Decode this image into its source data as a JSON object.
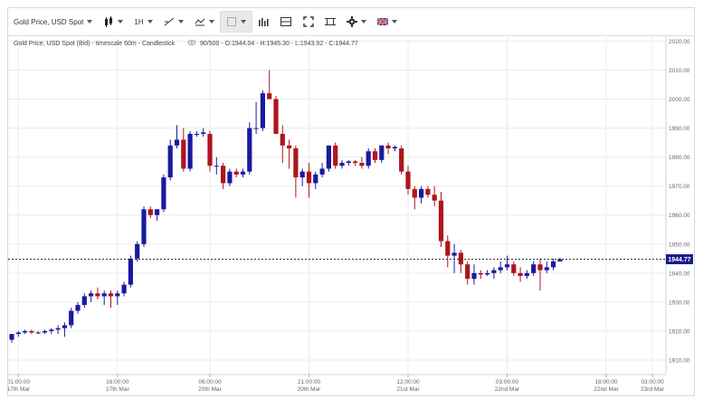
{
  "toolbar": {
    "instrument_label": "Gold Price, USD Spot",
    "timeframe_label": "1H"
  },
  "info_line": "Gold Price, USD Spot (Bid) - timescale 60m - Candlestick",
  "info_stats": "90/500 - O:1944.04 - H:1945.30 - L:1943.92 - C:1944.77",
  "current_price_label": "1944.77",
  "colors": {
    "up": "#1a1aa0",
    "down": "#b0141e",
    "grid": "#ececec",
    "axis_text": "#666666",
    "price_tag": "#1a1a8c"
  },
  "chart_data": {
    "type": "candlestick",
    "ylim": [
      1905,
      2022
    ],
    "yticks": [
      2020,
      2010,
      2000,
      1990,
      1980,
      1970,
      1960,
      1950,
      1940,
      1930,
      1920,
      1910
    ],
    "ytick_labels": [
      "2020.00",
      "2010.00",
      "2000.00",
      "1990.00",
      "1980.00",
      "1970.00",
      "1960.00",
      "1950.00",
      "1940.00",
      "1930.00",
      "1920.00",
      "1910.00"
    ],
    "xticks": [
      {
        "time": "01:00:00",
        "date": "17th Mar",
        "index": 1
      },
      {
        "time": "16:00:00",
        "date": "17th Mar",
        "index": 16
      },
      {
        "time": "06:00:00",
        "date": "20th Mar",
        "index": 30
      },
      {
        "time": "21:00:00",
        "date": "20th Mar",
        "index": 45
      },
      {
        "time": "12:00:00",
        "date": "21st Mar",
        "index": 60
      },
      {
        "time": "03:00:00",
        "date": "22nd Mar",
        "index": 75
      },
      {
        "time": "18:00:00",
        "date": "22nd Mar",
        "index": 90
      },
      {
        "time": "03:00:00",
        "date": "23rd Mar",
        "index": 97
      }
    ],
    "current_price": 1944.77,
    "candles": [
      [
        1917,
        1919,
        1916,
        1919
      ],
      [
        1919,
        1920,
        1918,
        1919.5
      ],
      [
        1919.5,
        1920.5,
        1919,
        1920
      ],
      [
        1920,
        1920.5,
        1919,
        1919.5
      ],
      [
        1919.5,
        1920,
        1919,
        1919.5
      ],
      [
        1919.5,
        1920.5,
        1919,
        1920
      ],
      [
        1920,
        1921,
        1919,
        1920.5
      ],
      [
        1920.5,
        1922,
        1919,
        1921
      ],
      [
        1921,
        1923,
        1918,
        1922
      ],
      [
        1922,
        1928,
        1921,
        1927
      ],
      [
        1927,
        1930,
        1926,
        1929
      ],
      [
        1929,
        1933,
        1928,
        1932
      ],
      [
        1932,
        1934,
        1930,
        1933
      ],
      [
        1933,
        1935,
        1931,
        1932
      ],
      [
        1932,
        1934,
        1929,
        1933
      ],
      [
        1933,
        1934,
        1928,
        1932
      ],
      [
        1932,
        1934,
        1929,
        1933
      ],
      [
        1933,
        1937,
        1932,
        1936
      ],
      [
        1936,
        1946,
        1935,
        1945
      ],
      [
        1945,
        1951,
        1944,
        1950
      ],
      [
        1950,
        1963,
        1949,
        1962
      ],
      [
        1962,
        1963,
        1959,
        1960
      ],
      [
        1960,
        1962,
        1958,
        1962
      ],
      [
        1962,
        1974,
        1961,
        1973
      ],
      [
        1973,
        1986,
        1972,
        1984
      ],
      [
        1984,
        1991,
        1983,
        1986
      ],
      [
        1986,
        1990,
        1975,
        1976
      ],
      [
        1976,
        1989,
        1975,
        1988
      ],
      [
        1988,
        1989,
        1987,
        1988
      ],
      [
        1988,
        1990,
        1987,
        1988.5
      ],
      [
        1988,
        1989,
        1975,
        1977
      ],
      [
        1977,
        1980,
        1974,
        1977
      ],
      [
        1977,
        1978,
        1969,
        1971
      ],
      [
        1971,
        1976,
        1970,
        1975
      ],
      [
        1975,
        1976,
        1973,
        1974
      ],
      [
        1974,
        1976,
        1973,
        1975
      ],
      [
        1975,
        1992,
        1974,
        1990
      ],
      [
        1990,
        1999,
        1988,
        1990
      ],
      [
        1990,
        2003,
        1989,
        2002
      ],
      [
        2002,
        2010,
        2001,
        2000
      ],
      [
        2000,
        2001,
        1988,
        1988
      ],
      [
        1988,
        1991,
        1978,
        1984
      ],
      [
        1984,
        1986,
        1976,
        1983
      ],
      [
        1983,
        1984,
        1966,
        1973
      ],
      [
        1973,
        1976,
        1970,
        1975
      ],
      [
        1975,
        1978,
        1966,
        1971
      ],
      [
        1971,
        1975,
        1969,
        1974
      ],
      [
        1974,
        1978,
        1973,
        1976
      ],
      [
        1976,
        1984,
        1975,
        1984
      ],
      [
        1984,
        1985,
        1976,
        1977
      ],
      [
        1977,
        1979,
        1976,
        1978
      ],
      [
        1978,
        1979,
        1977,
        1978.5
      ],
      [
        1978.5,
        1979,
        1977,
        1978
      ],
      [
        1978,
        1980,
        1976,
        1977
      ],
      [
        1977,
        1983,
        1976,
        1982
      ],
      [
        1982,
        1983,
        1978,
        1979
      ],
      [
        1979,
        1984,
        1978,
        1984
      ],
      [
        1984,
        1985,
        1981,
        1983
      ],
      [
        1983,
        1984,
        1982,
        1983.5
      ],
      [
        1983,
        1984,
        1974,
        1975
      ],
      [
        1975,
        1977,
        1967,
        1969
      ],
      [
        1969,
        1970,
        1962,
        1966
      ],
      [
        1966,
        1970,
        1964,
        1969
      ],
      [
        1969,
        1970,
        1966,
        1967
      ],
      [
        1967,
        1970,
        1963,
        1965
      ],
      [
        1965,
        1968,
        1949,
        1951
      ],
      [
        1951,
        1953,
        1942,
        1946
      ],
      [
        1946,
        1950,
        1940,
        1947
      ],
      [
        1947,
        1948,
        1940,
        1943
      ],
      [
        1943,
        1944,
        1936,
        1938
      ],
      [
        1938,
        1943,
        1936,
        1940
      ],
      [
        1940,
        1941,
        1938,
        1939.5
      ],
      [
        1939.5,
        1941,
        1939,
        1940
      ],
      [
        1940,
        1942,
        1938,
        1941
      ],
      [
        1941,
        1944,
        1940,
        1942
      ],
      [
        1942,
        1946,
        1941,
        1943
      ],
      [
        1943,
        1944,
        1939,
        1940
      ],
      [
        1940,
        1942,
        1937,
        1939
      ],
      [
        1939,
        1941,
        1938,
        1940
      ],
      [
        1940,
        1944,
        1939,
        1943
      ],
      [
        1943,
        1945,
        1934,
        1941
      ],
      [
        1941,
        1944,
        1940,
        1942
      ],
      [
        1942,
        1945,
        1941,
        1944
      ],
      [
        1944.04,
        1945.3,
        1943.92,
        1944.77
      ]
    ]
  }
}
